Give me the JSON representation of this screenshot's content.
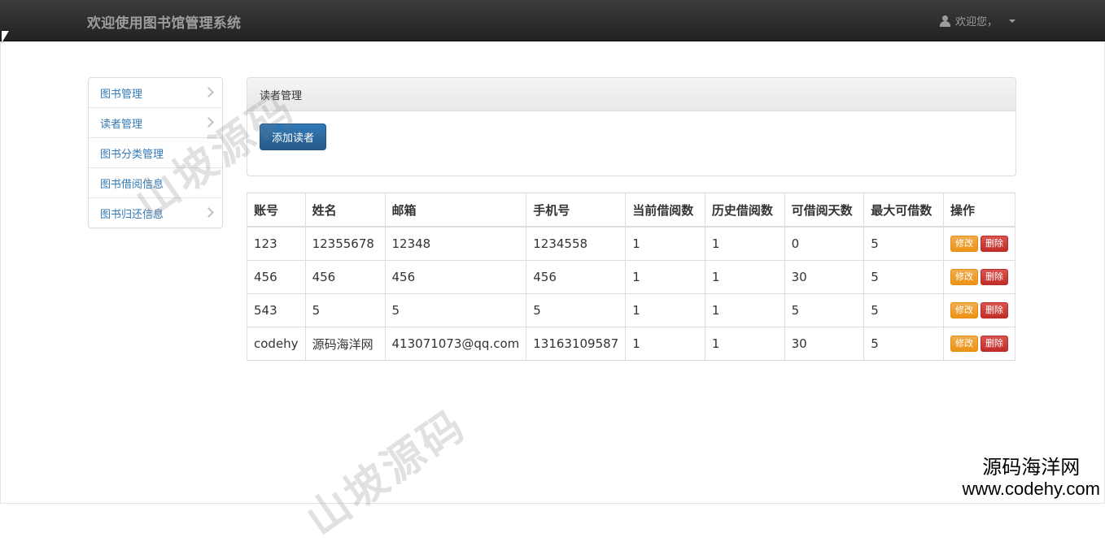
{
  "navbar": {
    "brand": "欢迎使用图书馆管理系统",
    "user_greeting": "欢迎您，"
  },
  "sidebar": {
    "items": [
      {
        "label": "图书管理"
      },
      {
        "label": "读者管理"
      },
      {
        "label": "图书分类管理"
      },
      {
        "label": "图书借阅信息"
      },
      {
        "label": "图书归还信息"
      }
    ]
  },
  "panel": {
    "title": "读者管理",
    "add_button": "添加读者"
  },
  "table": {
    "headers": [
      "账号",
      "姓名",
      "邮箱",
      "手机号",
      "当前借阅数",
      "历史借阅数",
      "可借阅天数",
      "最大可借数",
      "操作"
    ],
    "rows": [
      [
        "123",
        "12355678",
        "12348",
        "1234558",
        "1",
        "1",
        "0",
        "5"
      ],
      [
        "456",
        "456",
        "456",
        "456",
        "1",
        "1",
        "30",
        "5"
      ],
      [
        "543",
        "5",
        "5",
        "5",
        "1",
        "1",
        "5",
        "5"
      ],
      [
        "codehy",
        "源码海洋网",
        "413071073@qq.com",
        "13163109587",
        "1",
        "1",
        "30",
        "5"
      ]
    ],
    "edit_label": "修改",
    "delete_label": "删除"
  },
  "watermark": {
    "text": "山坡源码",
    "site_name": "源码海洋网",
    "site_url": "www.codehy.com"
  }
}
